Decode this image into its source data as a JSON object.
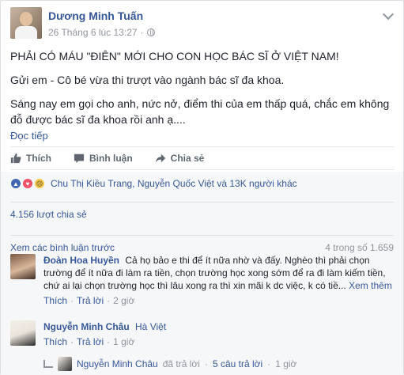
{
  "post": {
    "author": "Dương Minh Tuấn",
    "time": "26 Tháng 6 lúc 13:27",
    "paragraphs": [
      "PHẢI CÓ MÁU \"ĐIÊN\" MỚI CHO CON HỌC BÁC SĨ Ở VIỆT NAM!",
      "Gửi em - Cô bé vừa thi trượt vào ngành bác sĩ đa khoa.",
      "Sáng nay em gọi cho anh, nức nở, điểm thi của em thấp quá, chắc em không đỗ được bác sĩ đa khoa rồi anh ạ...."
    ],
    "more_label": "Đọc tiếp"
  },
  "actions": {
    "like": "Thích",
    "comment": "Bình luận",
    "share": "Chia sẻ"
  },
  "reactions": {
    "summary": "Chu Thị Kiều Trang, Nguyễn Quốc Việt và 13K người khác",
    "icons": [
      "like-icon",
      "love-icon",
      "sad-icon"
    ]
  },
  "shares": "4.156 lượt chia sẻ",
  "comments_header": {
    "view_previous": "Xem các bình luận trước",
    "count": "4 trong số 1.659"
  },
  "comments": [
    {
      "name": "Đoàn Hoa Huyền",
      "text": "Cả họ bảo e thi để ít nữa nhờ và đấy. Nghèo thì phải chọn trường để ít nữa đi làm ra tiền, chọn trường học xong sớm để ra đi làm kiếm tiền, chứ ai lại chọn trường học thì lâu xong ra thì xin mãi k dc việc, k có tiề...",
      "more": "Xem thêm",
      "like": "Thích",
      "reply": "Trả lời",
      "time": "2 giờ"
    },
    {
      "name": "Nguyễn Minh Châu",
      "tag": "Hà Việt",
      "like": "Thích",
      "reply": "Trả lời",
      "time": "1 giờ"
    }
  ],
  "reply_row": {
    "name": "Nguyễn Minh Châu",
    "text": "đã trả lời",
    "sep": "·",
    "count": "5 câu trả lời",
    "time": "1 giờ"
  }
}
